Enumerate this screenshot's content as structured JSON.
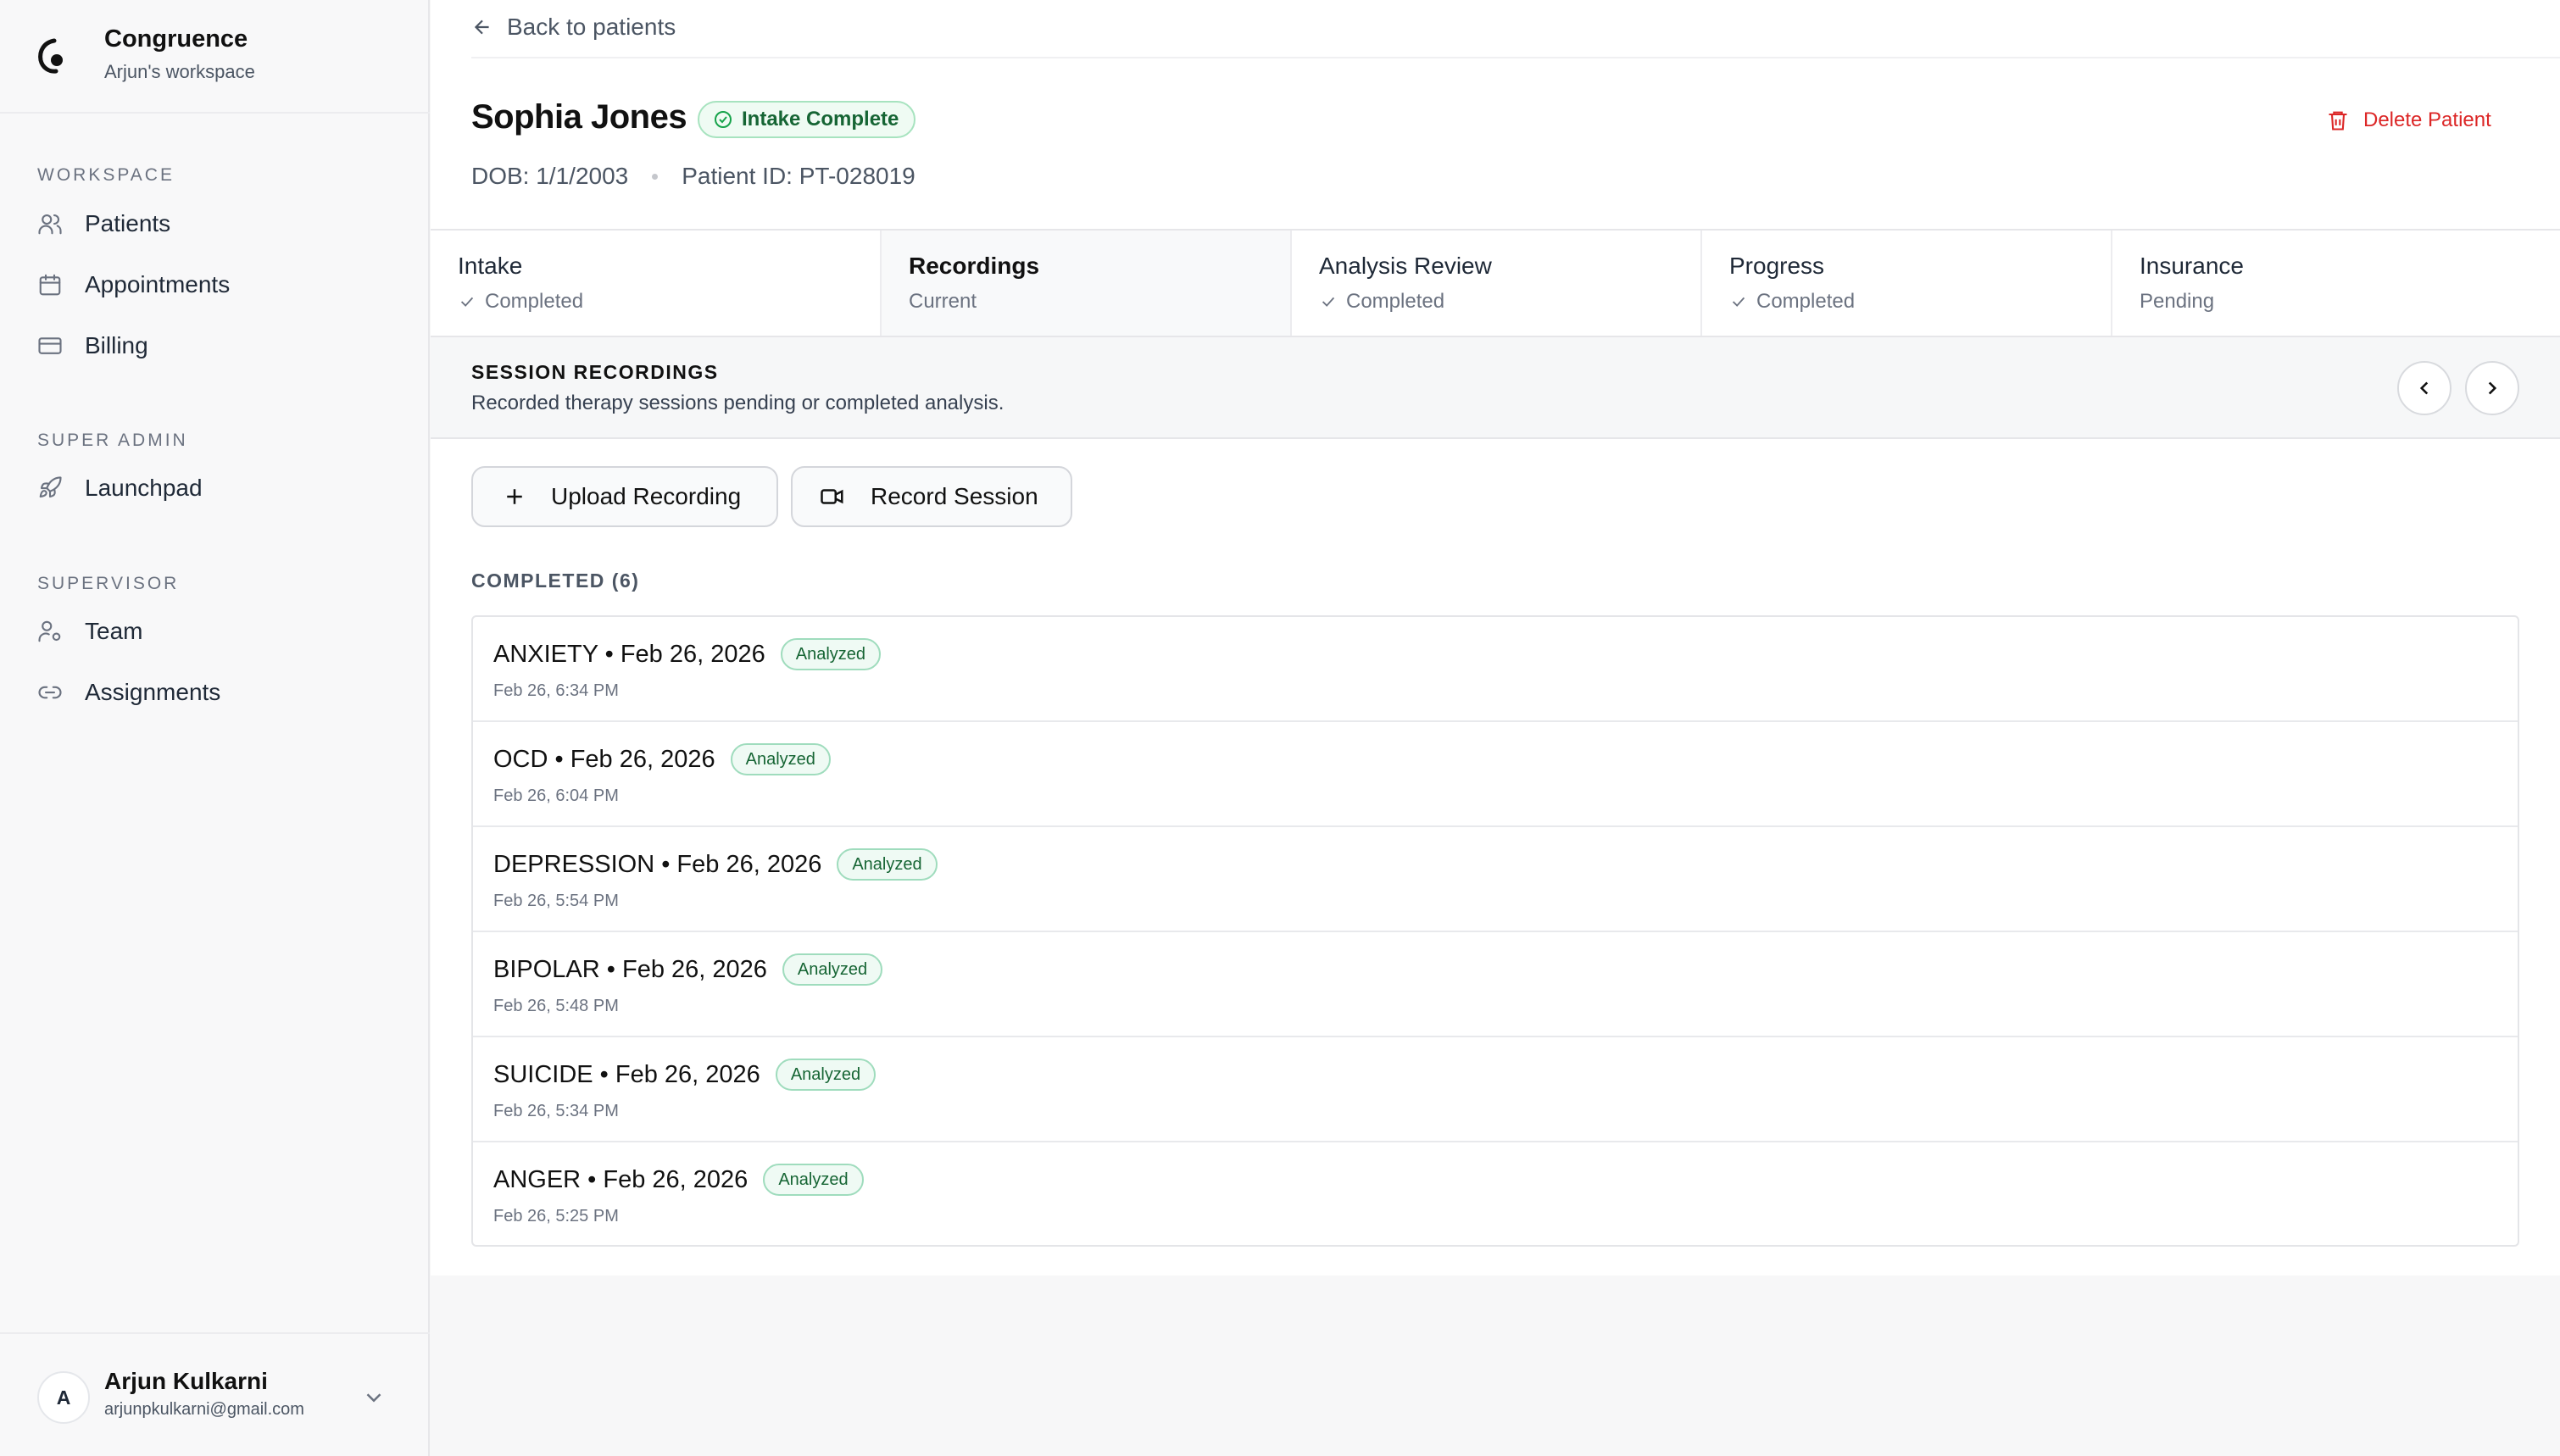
{
  "sidebar": {
    "brand_name": "Congruence",
    "brand_sub": "Arjun's workspace",
    "sections": [
      {
        "label": "WORKSPACE",
        "items": [
          "Patients",
          "Appointments",
          "Billing"
        ]
      },
      {
        "label": "SUPER ADMIN",
        "items": [
          "Launchpad"
        ]
      },
      {
        "label": "SUPERVISOR",
        "items": [
          "Team",
          "Assignments"
        ]
      }
    ],
    "user": {
      "initial": "A",
      "name": "Arjun Kulkarni",
      "email": "arjunpkulkarni@gmail.com"
    }
  },
  "header": {
    "back_label": "Back to patients",
    "patient_name": "Sophia Jones",
    "intake_badge": "Intake Complete",
    "dob": "DOB: 1/1/2003",
    "patient_id": "Patient ID: PT-028019",
    "delete_label": "Delete Patient"
  },
  "tabs": [
    {
      "title": "Intake",
      "status": "Completed"
    },
    {
      "title": "Recordings",
      "status": "Current"
    },
    {
      "title": "Analysis Review",
      "status": "Completed"
    },
    {
      "title": "Progress",
      "status": "Completed"
    },
    {
      "title": "Insurance",
      "status": "Pending"
    }
  ],
  "section": {
    "title": "SESSION RECORDINGS",
    "subtitle": "Recorded therapy sessions pending or completed analysis."
  },
  "actions": {
    "upload_label": "Upload Recording",
    "record_label": "Record Session"
  },
  "list": {
    "label": "COMPLETED (6)",
    "items": [
      {
        "title": "ANXIETY • Feb 26, 2026",
        "badge": "Analyzed",
        "time": "Feb 26, 6:34 PM"
      },
      {
        "title": "OCD • Feb 26, 2026",
        "badge": "Analyzed",
        "time": "Feb 26, 6:04 PM"
      },
      {
        "title": "DEPRESSION • Feb 26, 2026",
        "badge": "Analyzed",
        "time": "Feb 26, 5:54 PM"
      },
      {
        "title": "BIPOLAR • Feb 26, 2026",
        "badge": "Analyzed",
        "time": "Feb 26, 5:48 PM"
      },
      {
        "title": "SUICIDE • Feb 26, 2026",
        "badge": "Analyzed",
        "time": "Feb 26, 5:34 PM"
      },
      {
        "title": "ANGER • Feb 26, 2026",
        "badge": "Analyzed",
        "time": "Feb 26, 5:25 PM"
      }
    ]
  },
  "colors": {
    "accent_green": "#16a34a",
    "danger": "#dc2626"
  }
}
